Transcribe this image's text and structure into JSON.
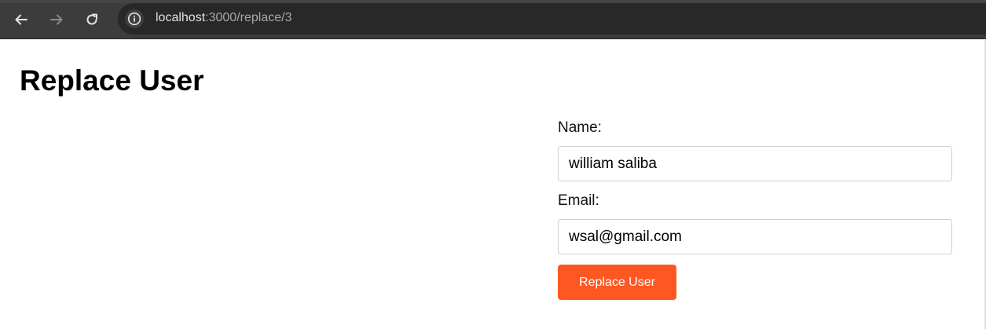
{
  "browser": {
    "url_host": "localhost",
    "url_path": ":3000/replace/3",
    "back_icon": "arrow-left-icon",
    "forward_icon": "arrow-right-icon",
    "reload_icon": "reload-icon",
    "site_info_icon": "info-icon"
  },
  "page": {
    "title": "Replace User"
  },
  "form": {
    "name_label": "Name:",
    "name_value": "william saliba",
    "email_label": "Email:",
    "email_value": "wsal@gmail.com",
    "submit_label": "Replace User",
    "submit_color": "#ff5722"
  }
}
